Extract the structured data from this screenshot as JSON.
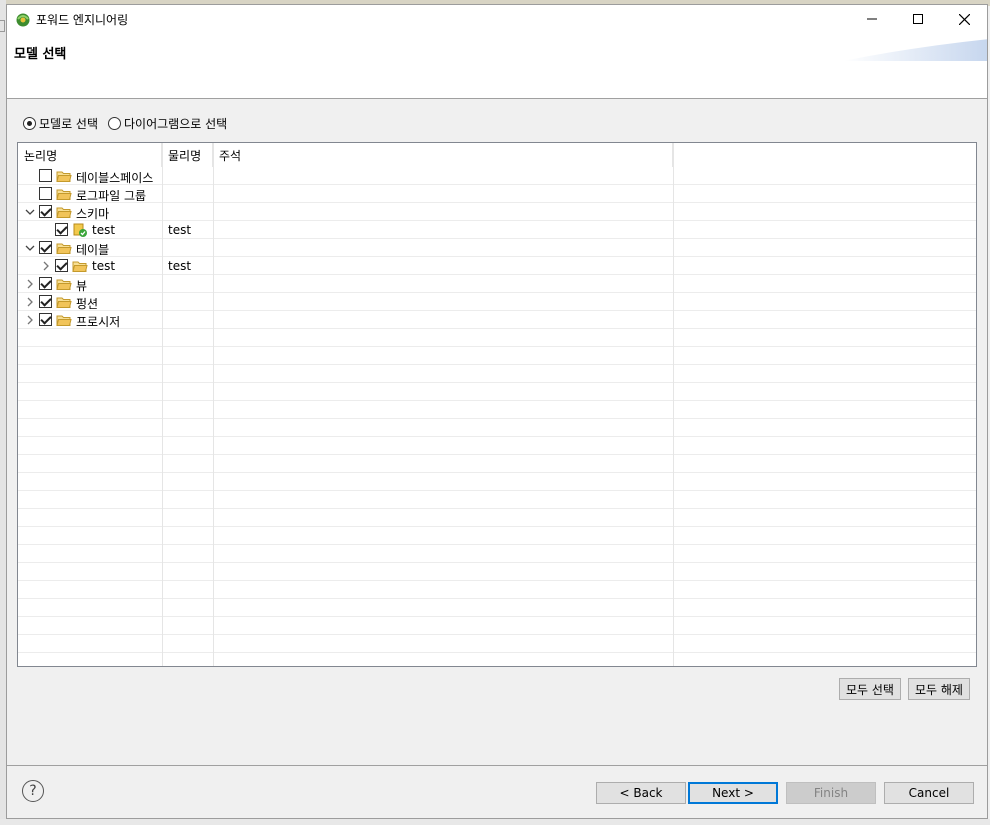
{
  "window": {
    "title": "포워드 엔지니어링",
    "minimize": "—",
    "maximize": "☐",
    "close": "✕"
  },
  "banner": {
    "title": "모델 선택"
  },
  "selection_mode": {
    "options": [
      {
        "label": "모델로 선택",
        "selected": true
      },
      {
        "label": "다이어그램으로 선택",
        "selected": false
      }
    ]
  },
  "tree": {
    "columns": [
      "논리명",
      "물리명",
      "주석"
    ],
    "rows": [
      {
        "label": "테이블스페이스",
        "physical": "",
        "comment": "",
        "level": 0,
        "twisty": "none",
        "checked": false,
        "icon": "folder-icon"
      },
      {
        "label": "로그파일 그룹",
        "physical": "",
        "comment": "",
        "level": 0,
        "twisty": "none",
        "checked": false,
        "icon": "folder-icon"
      },
      {
        "label": "스키마",
        "physical": "",
        "comment": "",
        "level": 0,
        "twisty": "expanded",
        "checked": true,
        "icon": "folder-icon"
      },
      {
        "label": "test",
        "physical": "test",
        "comment": "",
        "level": 1,
        "twisty": "none",
        "checked": true,
        "icon": "schema-icon"
      },
      {
        "label": "테이블",
        "physical": "",
        "comment": "",
        "level": 0,
        "twisty": "expanded",
        "checked": true,
        "icon": "folder-icon"
      },
      {
        "label": "test",
        "physical": "test",
        "comment": "",
        "level": 1,
        "twisty": "collapsed",
        "checked": true,
        "icon": "folder-icon"
      },
      {
        "label": "뷰",
        "physical": "",
        "comment": "",
        "level": 0,
        "twisty": "collapsed",
        "checked": true,
        "icon": "folder-icon"
      },
      {
        "label": "펑션",
        "physical": "",
        "comment": "",
        "level": 0,
        "twisty": "collapsed",
        "checked": true,
        "icon": "folder-icon"
      },
      {
        "label": "프로시저",
        "physical": "",
        "comment": "",
        "level": 0,
        "twisty": "collapsed",
        "checked": true,
        "icon": "folder-icon"
      }
    ],
    "empty_rows": 18
  },
  "actions": {
    "select_all": "모두 선택",
    "deselect_all": "모두 해제"
  },
  "footer": {
    "help": "?",
    "back": "< Back",
    "next": "Next >",
    "finish": "Finish",
    "cancel": "Cancel"
  },
  "colors": {
    "accent": "#0078d7",
    "folder": "#e8b94a",
    "schema_badge": "#3aa53a"
  }
}
